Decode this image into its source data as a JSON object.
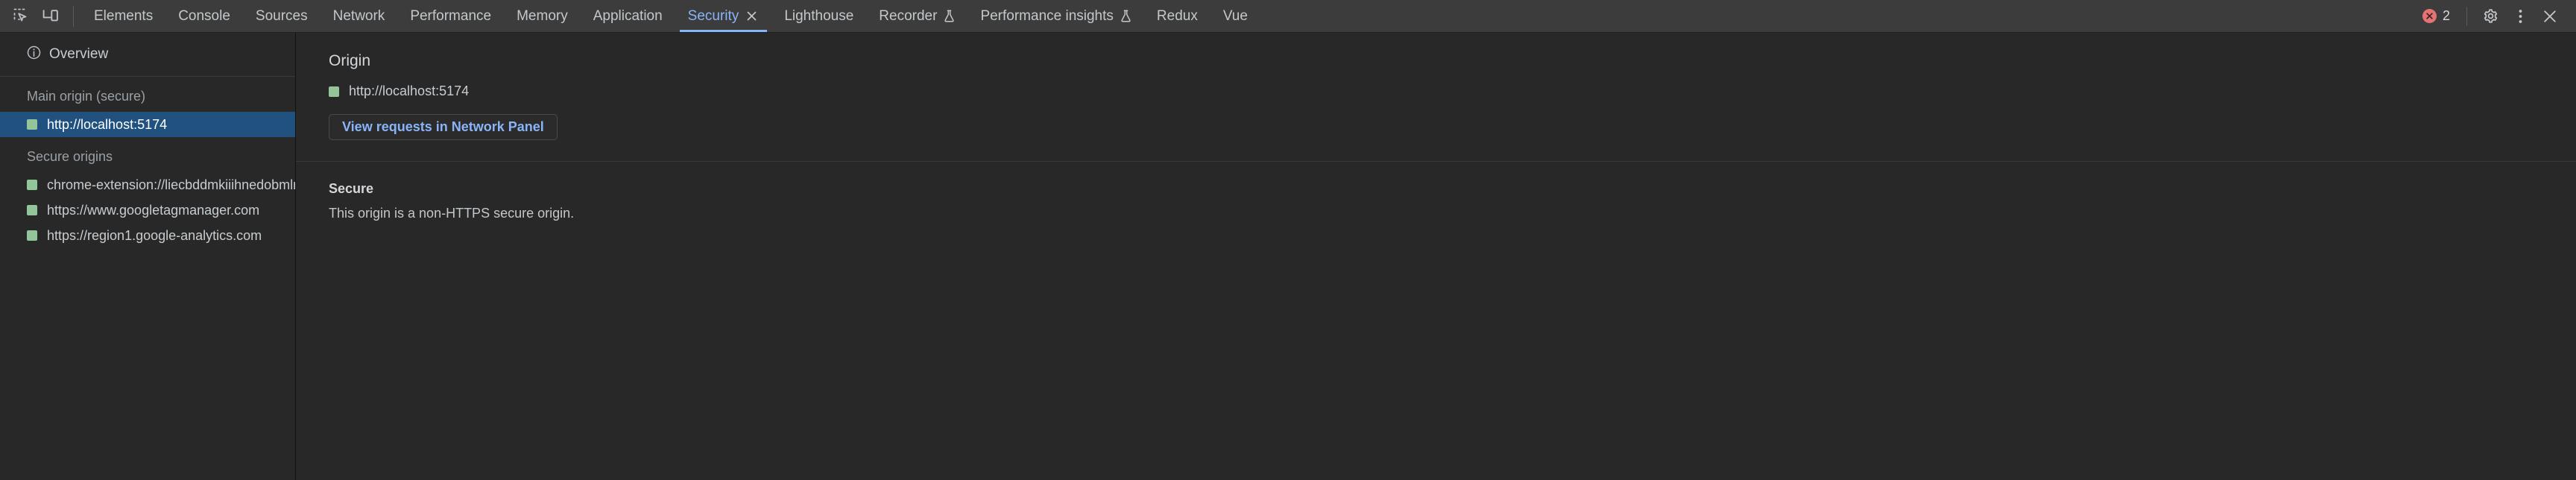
{
  "toolbar": {
    "inspect_icon": "inspect-element-icon",
    "device_icon": "device-toolbar-icon",
    "tabs": [
      {
        "label": "Elements",
        "active": false,
        "experimental": false,
        "closable": false
      },
      {
        "label": "Console",
        "active": false,
        "experimental": false,
        "closable": false
      },
      {
        "label": "Sources",
        "active": false,
        "experimental": false,
        "closable": false
      },
      {
        "label": "Network",
        "active": false,
        "experimental": false,
        "closable": false
      },
      {
        "label": "Performance",
        "active": false,
        "experimental": false,
        "closable": false
      },
      {
        "label": "Memory",
        "active": false,
        "experimental": false,
        "closable": false
      },
      {
        "label": "Application",
        "active": false,
        "experimental": false,
        "closable": false
      },
      {
        "label": "Security",
        "active": true,
        "experimental": false,
        "closable": true
      },
      {
        "label": "Lighthouse",
        "active": false,
        "experimental": false,
        "closable": false
      },
      {
        "label": "Recorder",
        "active": false,
        "experimental": true,
        "closable": false
      },
      {
        "label": "Performance insights",
        "active": false,
        "experimental": true,
        "closable": false
      },
      {
        "label": "Redux",
        "active": false,
        "experimental": false,
        "closable": false
      },
      {
        "label": "Vue",
        "active": false,
        "experimental": false,
        "closable": false
      }
    ],
    "error_count": "2",
    "error_icon": "error-circle-icon",
    "settings_icon": "gear-icon",
    "more_icon": "more-vertical-icon",
    "close_icon": "close-icon",
    "accent_color": "#8ab4f8",
    "error_color": "#e57373"
  },
  "sidebar": {
    "overview": {
      "label": "Overview",
      "icon": "info-circle-icon"
    },
    "groups": [
      {
        "title": "Main origin (secure)",
        "items": [
          {
            "label": "http://localhost:5174",
            "state_icon": "secure-green-square-icon",
            "selected": true
          }
        ]
      },
      {
        "title": "Secure origins",
        "items": [
          {
            "label": "chrome-extension://liecbddmkiiihnedobmlmillhodjkdmb",
            "state_icon": "secure-green-square-icon",
            "selected": false
          },
          {
            "label": "https://www.googletagmanager.com",
            "state_icon": "secure-green-square-icon",
            "selected": false
          },
          {
            "label": "https://region1.google-analytics.com",
            "state_icon": "secure-green-square-icon",
            "selected": false
          }
        ]
      }
    ],
    "selection_color": "#21517f",
    "secure_color": "#92c69a"
  },
  "main": {
    "origin_heading": "Origin",
    "origin_value": "http://localhost:5174",
    "origin_state_icon": "secure-green-square-icon",
    "view_requests_button": "View requests in Network Panel",
    "security_section": {
      "title": "Secure",
      "description": "This origin is a non-HTTPS secure origin."
    }
  }
}
